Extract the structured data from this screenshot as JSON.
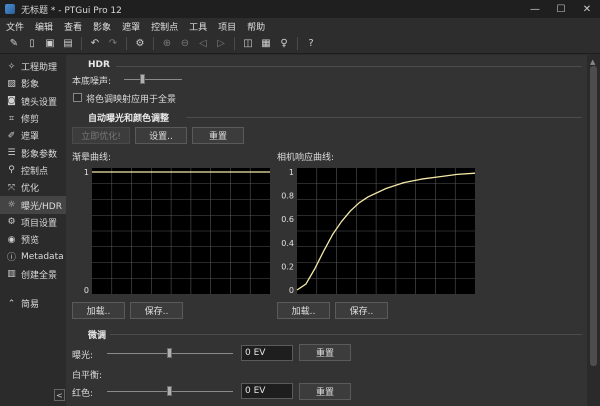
{
  "window": {
    "title": "无标题 * - PTGui Pro 12",
    "minimize": "—",
    "maximize": "☐",
    "close": "✕"
  },
  "menu": [
    "文件",
    "编辑",
    "查看",
    "影象",
    "遮罩",
    "控制点",
    "工具",
    "项目",
    "帮助"
  ],
  "sidebar": {
    "items": [
      {
        "label": "工程助理",
        "icon": "sparkle-icon"
      },
      {
        "label": "影象",
        "icon": "image-icon"
      },
      {
        "label": "镜头设置",
        "icon": "camera-icon"
      },
      {
        "label": "修剪",
        "icon": "crop-icon"
      },
      {
        "label": "遮罩",
        "icon": "brush-icon"
      },
      {
        "label": "影象参数",
        "icon": "sliders-icon"
      },
      {
        "label": "控制点",
        "icon": "pin-icon"
      },
      {
        "label": "优化",
        "icon": "optimize-icon"
      },
      {
        "label": "曝光/HDR",
        "icon": "sun-icon"
      },
      {
        "label": "项目设置",
        "icon": "gear-icon"
      },
      {
        "label": "预览",
        "icon": "eye-icon"
      },
      {
        "label": "Metadata",
        "icon": "info-icon"
      },
      {
        "label": "创建全景",
        "icon": "panorama-icon"
      }
    ],
    "simple_label": "简易",
    "collapse": "<"
  },
  "hdr": {
    "title": "HDR",
    "noise_label": "本底噪声:",
    "noise_level": 0.33,
    "apply_tonemap_label": "将色调映射应用于全景",
    "apply_tonemap_checked": false
  },
  "auto_exposure": {
    "title": "自动曝光和颜色调整",
    "optimize_now": "立即优化!",
    "settings": "设置..",
    "reset": "重置"
  },
  "curves": {
    "gradient_label": "渐晕曲线:",
    "response_label": "相机响应曲线:",
    "load": "加载..",
    "save": "保存.."
  },
  "fine_tune": {
    "title": "微调",
    "exposure_label": "曝光:",
    "exposure_value": "0 EV",
    "exposure_level": 0.5,
    "exposure_reset": "重置",
    "wb_label": "白平衡:",
    "red_label": "红色:",
    "red_value": "0 EV",
    "red_level": 0.5,
    "red_reset": "重置"
  },
  "colors": {
    "curve": "#f5e9a8",
    "grid": "#555555",
    "plot_bg": "#000000"
  },
  "chart_data": [
    {
      "type": "line",
      "title": "渐晕曲线:",
      "x": [
        0,
        0.25,
        0.5,
        0.75,
        1
      ],
      "series": [
        {
          "values": [
            1,
            1,
            1,
            1,
            1
          ]
        }
      ],
      "ylim": [
        0,
        1
      ],
      "yticks": [
        "0",
        "1"
      ],
      "grid": true
    },
    {
      "type": "line",
      "title": "相机响应曲线:",
      "x": [
        0,
        0.05,
        0.1,
        0.15,
        0.2,
        0.25,
        0.3,
        0.35,
        0.4,
        0.5,
        0.6,
        0.7,
        0.8,
        0.9,
        1.0
      ],
      "series": [
        {
          "values": [
            0,
            0.05,
            0.18,
            0.33,
            0.47,
            0.58,
            0.67,
            0.74,
            0.79,
            0.86,
            0.91,
            0.94,
            0.96,
            0.98,
            0.99
          ]
        }
      ],
      "ylim": [
        0,
        1
      ],
      "yticks": [
        "0",
        "0.2",
        "0.4",
        "0.6",
        "0.8",
        "1"
      ],
      "grid": true
    }
  ]
}
